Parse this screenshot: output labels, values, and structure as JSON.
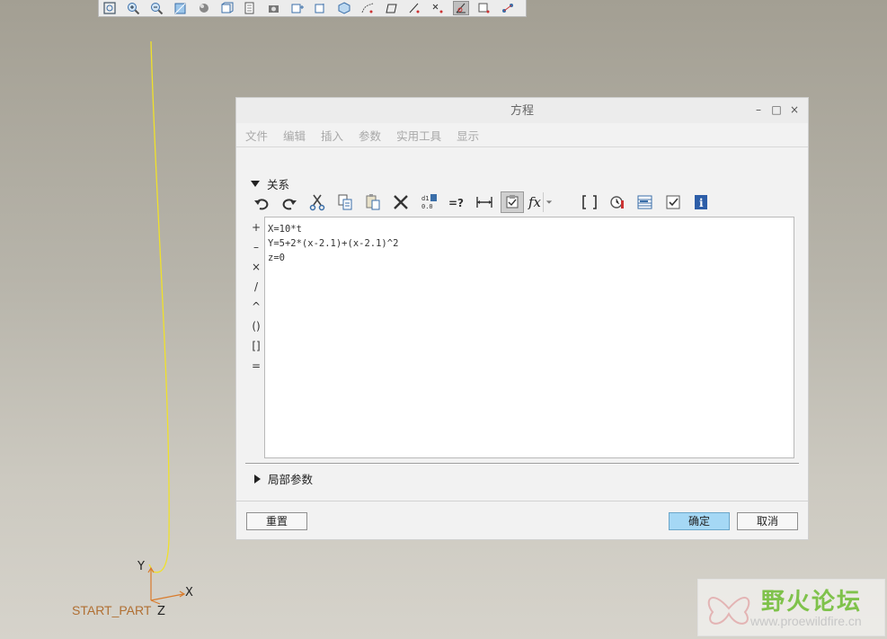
{
  "top_toolbar": {
    "icons": [
      "zoom-fit-icon",
      "zoom-in-icon",
      "zoom-out-icon",
      "reorient-icon",
      "shading-icon",
      "display-style-icon",
      "saved-views-icon",
      "named-view-icon",
      "plane-display-icon",
      "axis-display-icon",
      "3d-view-icon",
      "point-display-icon",
      "sketch-icon",
      "csys-display-icon",
      "datum-point-icon",
      "spin-center-icon",
      "annotation-display-icon",
      "curve-display-icon"
    ]
  },
  "canvas": {
    "csys_x_label": "X",
    "csys_y_label": "Y",
    "csys_z_label": "Z",
    "part_label": "START_PART",
    "curve_color": "#f0e12a"
  },
  "dialog": {
    "title": "方程",
    "window_buttons": [
      "–",
      "□",
      "×"
    ],
    "menu": [
      "文件",
      "编辑",
      "插入",
      "参数",
      "实用工具",
      "显示"
    ],
    "relations_section": "关系",
    "relation_tools": [
      "undo-icon",
      "redo-icon",
      "cut-icon",
      "copy-icon",
      "paste-icon",
      "delete-icon",
      "sort-icon",
      "evaluate-icon",
      "dimension-icon",
      "verify-icon",
      "function-icon",
      "brackets-icon",
      "unit-sensitive-icon",
      "parameter-table-icon",
      "check-icon",
      "info-icon"
    ],
    "fx_label": "fx",
    "brackets_label": "()",
    "eq_q_label": "=?",
    "operators": [
      "+",
      "–",
      "×",
      "/",
      "^",
      "()",
      "[]",
      "="
    ],
    "equations": [
      "X=10*t",
      "Y=5+2*(x-2.1)+(x-2.1)^2",
      "z=0"
    ],
    "local_params_section": "局部参数",
    "reset_button": "重置",
    "ok_button": "确定",
    "cancel_button": "取消"
  },
  "watermark": {
    "title": "野火论坛",
    "url": "www.proewildfire.cn"
  }
}
